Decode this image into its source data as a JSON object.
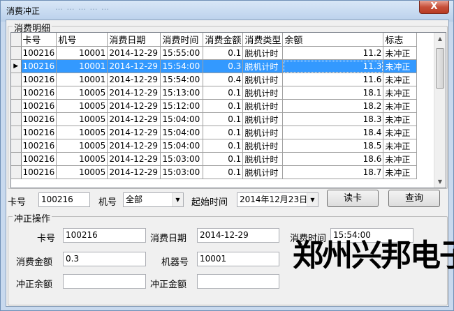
{
  "window": {
    "title": "消费冲正",
    "close_glyph": "X",
    "ghost_menu": "…  …  …  …  …"
  },
  "detail_group": {
    "legend": "消费明细",
    "columns": [
      "卡号",
      "机号",
      "消费日期",
      "消费时间",
      "消费金额",
      "消费类型",
      "余额",
      "标志"
    ],
    "rows": [
      {
        "card": "100216",
        "machine": "10001",
        "date": "2014-12-29",
        "time": "15:55:00",
        "amount": "0.1",
        "type": "脱机计时",
        "balance": "11.2",
        "flag": "未冲正",
        "selected": false
      },
      {
        "card": "100216",
        "machine": "10001",
        "date": "2014-12-29",
        "time": "15:54:00",
        "amount": "0.3",
        "type": "脱机计时",
        "balance": "11.3",
        "flag": "未冲正",
        "selected": true
      },
      {
        "card": "100216",
        "machine": "10001",
        "date": "2014-12-29",
        "time": "15:54:00",
        "amount": "0.4",
        "type": "脱机计时",
        "balance": "11.6",
        "flag": "未冲正",
        "selected": false
      },
      {
        "card": "100216",
        "machine": "10005",
        "date": "2014-12-29",
        "time": "15:13:00",
        "amount": "0.1",
        "type": "脱机计时",
        "balance": "18.1",
        "flag": "未冲正",
        "selected": false
      },
      {
        "card": "100216",
        "machine": "10005",
        "date": "2014-12-29",
        "time": "15:12:00",
        "amount": "0.1",
        "type": "脱机计时",
        "balance": "18.2",
        "flag": "未冲正",
        "selected": false
      },
      {
        "card": "100216",
        "machine": "10005",
        "date": "2014-12-29",
        "time": "15:04:00",
        "amount": "0.1",
        "type": "脱机计时",
        "balance": "18.3",
        "flag": "未冲正",
        "selected": false
      },
      {
        "card": "100216",
        "machine": "10005",
        "date": "2014-12-29",
        "time": "15:04:00",
        "amount": "0.1",
        "type": "脱机计时",
        "balance": "18.4",
        "flag": "未冲正",
        "selected": false
      },
      {
        "card": "100216",
        "machine": "10005",
        "date": "2014-12-29",
        "time": "15:04:00",
        "amount": "0.1",
        "type": "脱机计时",
        "balance": "18.5",
        "flag": "未冲正",
        "selected": false
      },
      {
        "card": "100216",
        "machine": "10005",
        "date": "2014-12-29",
        "time": "15:03:00",
        "amount": "0.1",
        "type": "脱机计时",
        "balance": "18.6",
        "flag": "未冲正",
        "selected": false
      },
      {
        "card": "100216",
        "machine": "10005",
        "date": "2014-12-29",
        "time": "15:03:00",
        "amount": "0.1",
        "type": "脱机计时",
        "balance": "18.7",
        "flag": "未冲正",
        "selected": false
      }
    ],
    "row_indicator": "▶"
  },
  "query_bar": {
    "card_label": "卡号",
    "card_value": "100216",
    "machine_label": "机号",
    "machine_value": "全部",
    "start_label": "起始时间",
    "start_value": "2014年12月23日",
    "read_card_button": "读卡",
    "query_button": "查询"
  },
  "reverse_group": {
    "legend": "冲正操作",
    "card_label": "卡号",
    "card_value": "100216",
    "date_label": "消费日期",
    "date_value": "2014-12-29",
    "time_label": "消费时间",
    "time_value": "15:54:00",
    "amount_label": "消费金额",
    "amount_value": "0.3",
    "machine_label": "机器号",
    "machine_value": "10001",
    "rev_balance_label": "冲正余额",
    "rev_balance_value": "",
    "rev_amount_label": "冲正金额",
    "rev_amount_value": ""
  },
  "watermark": {
    "text": "郑州兴邦电子"
  },
  "colors": {
    "selection": "#3399ff",
    "title_gradient_top": "#d9e7f7",
    "close_button": "#c7503a"
  }
}
